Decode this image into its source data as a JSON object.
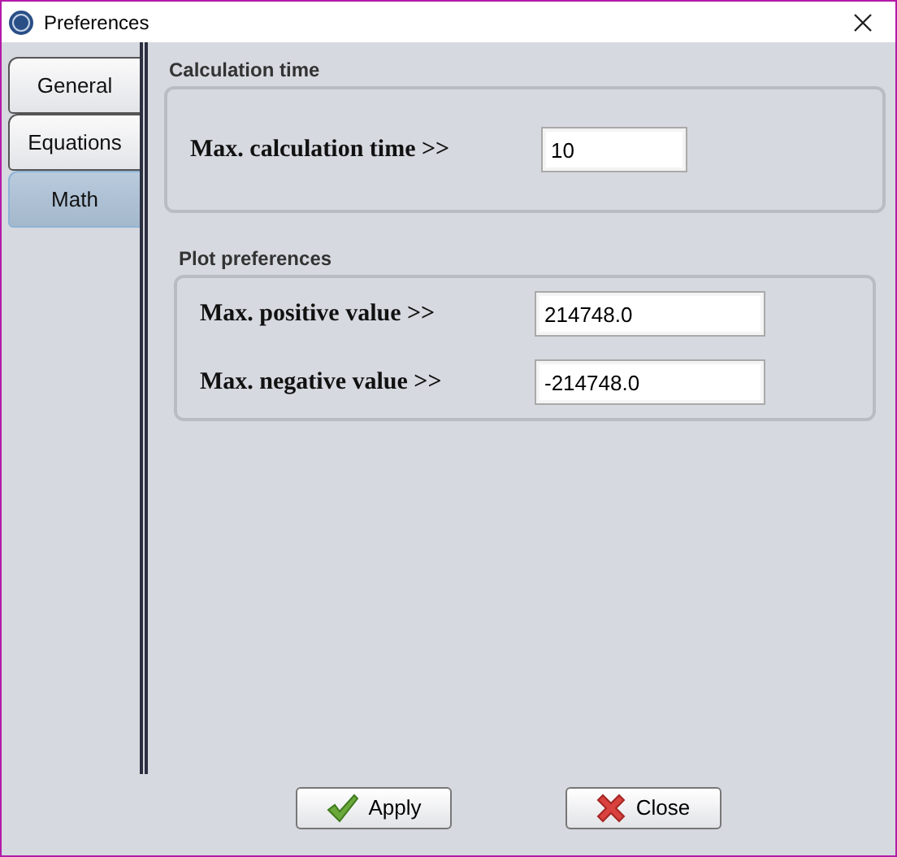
{
  "window": {
    "title": "Preferences"
  },
  "tabs": [
    {
      "label": "General",
      "selected": false
    },
    {
      "label": "Equations",
      "selected": false
    },
    {
      "label": "Math",
      "selected": true
    }
  ],
  "calculation_time": {
    "title": "Calculation time",
    "fields": [
      {
        "label": "Max. calculation time >>",
        "value": "10"
      }
    ]
  },
  "plot_preferences": {
    "title": "Plot preferences",
    "fields": [
      {
        "label": "Max. positive value >>",
        "value": "214748.0"
      },
      {
        "label": "Max. negative value >>",
        "value": "-214748.0"
      }
    ]
  },
  "buttons": [
    {
      "label": "Apply",
      "kind": "apply"
    },
    {
      "label": "Close",
      "kind": "close"
    }
  ]
}
